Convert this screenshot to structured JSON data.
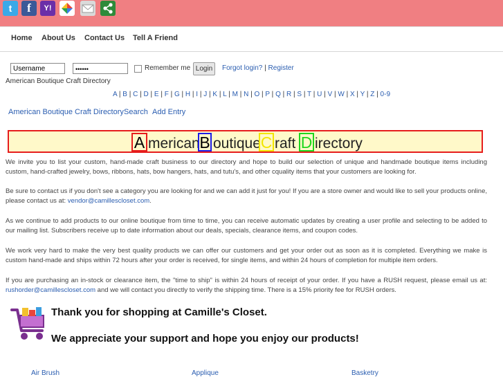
{
  "share": {
    "twitter": "t",
    "facebook": "f",
    "yahoo": "Y!"
  },
  "nav": {
    "home": "Home",
    "about": "About Us",
    "contact": "Contact Us",
    "tell": "Tell A Friend"
  },
  "login": {
    "username_value": "Username",
    "password_value": "••••••",
    "remember_label": "Remember me",
    "login_button": "Login",
    "forgot_link": "Forgot login?",
    "separator": "|",
    "register_link": "Register"
  },
  "breadcrumb": "American Boutique Craft Directory",
  "alphabet": [
    "A",
    "B",
    "C",
    "D",
    "E",
    "F",
    "G",
    "H",
    "I",
    "J",
    "K",
    "L",
    "M",
    "N",
    "O",
    "P",
    "Q",
    "R",
    "S",
    "T",
    "U",
    "V",
    "W",
    "X",
    "Y",
    "Z",
    "0-9"
  ],
  "subnav": {
    "directory": "American Boutique Craft Directory",
    "search": "Search",
    "add": "Add Entry"
  },
  "banner": {
    "a_cap": "A",
    "a_rest": "merican",
    "b_cap": "B",
    "b_rest": "outique",
    "c_cap": "C",
    "c_rest": "raft",
    "d_cap": "D",
    "d_rest": "irectory",
    "colors": {
      "a": "#e61c1c",
      "b": "#1c1ce6",
      "c": "#f2e600",
      "d": "#1ed61e"
    }
  },
  "paragraphs": {
    "p1": "We invite you to list your custom, hand-made craft business to our directory and hope to build our selection of unique and handmade boutique items including custom, hand-crafted jewelry, bows, ribbons, hats, bow hangers, hats, and tutu's, and other cquality items that your customers are looking for.",
    "p2_text": "Be sure to contact us if you don't see a category you are looking for and we can add it just for you! If you are a store owner and would like to sell your products online, please contact us at: ",
    "p2_link": "vendor@camillescloset.com",
    "p2_end": ".",
    "p3": "As we continue to add products to our online boutique from time to time, you can receive automatic updates by creating a user profile and selecting to be added to our mailing list. Subscribers receive up to date information about our deals, specials, clearance items, and coupon codes.",
    "p4": "We work very hard to make the very best quality products we can offer our customers and get your order out as soon as it is completed. Everything we make is custom hand-made and ships within 72 hours after your order is received, for single items, and within 24 hours of completion for multiple item orders.",
    "p5_text": "If you are purchasing an in-stock or clearance item, the \"time to ship\" is within 24 hours of receipt of your order. If you have a RUSH request, please email us at: ",
    "p5_link": "rushorder@camillescloset.com",
    "p5_end": " and we will contact you directly to verify the shipping time.  There is a 15% priority fee for RUSH orders."
  },
  "thanks": {
    "line1": "Thank you for shopping at Camille's Closet.",
    "line2": "We appreciate your support and hope you enjoy our products!"
  },
  "categories": [
    "Air Brush",
    "Applique",
    "Basketry"
  ],
  "icons": {
    "share": [
      "twitter-icon",
      "facebook-icon",
      "yahoo-icon",
      "google-icon",
      "mail-icon",
      "share-icon"
    ],
    "cart": "shopping-cart-icon"
  }
}
